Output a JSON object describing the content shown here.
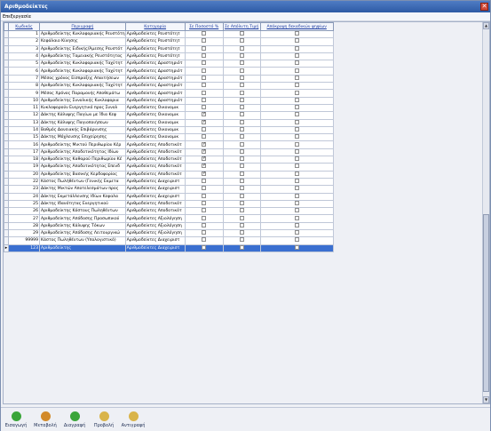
{
  "window": {
    "title": "Αριθμοδείκτες",
    "close_glyph": "✕"
  },
  "menu": {
    "tools": "Επεξεργασία"
  },
  "grid": {
    "columns": [
      "Κωδικός",
      "Περιγραφή",
      "Κατηγορία",
      "Σε Ποσοστό %",
      "Σε Απόλυτη Τιμή",
      "Απόκρυψη δεκαδικών ψηφίων"
    ],
    "rows": [
      {
        "code": "1",
        "desc": "Αριθμοδείκτης Κυκλοφοριακής Ρευστότη",
        "cat": "Αριθμοδείκτες Ρευστότητ",
        "pct": false,
        "abs": false,
        "hide": false
      },
      {
        "code": "2",
        "desc": "Κεφάλαιο Κίνησης",
        "cat": "Αριθμοδείκτες Ρευστότητ",
        "pct": false,
        "abs": false,
        "hide": false
      },
      {
        "code": "3",
        "desc": "Αριθμοδείκτης Ειδικής/Άμεσης Ρευστότ",
        "cat": "Αριθμοδείκτες Ρευστότητ",
        "pct": false,
        "abs": false,
        "hide": false
      },
      {
        "code": "4",
        "desc": "Αριθμοδείκτης Ταμειακής Ρευστότητας",
        "cat": "Αριθμοδείκτες Ρευστότητ",
        "pct": false,
        "abs": false,
        "hide": false
      },
      {
        "code": "5",
        "desc": "Αριθμοδείκτης Κυκλοφοριακής Ταχύτητ",
        "cat": "Αριθμοδείκτες Δραστηριότ",
        "pct": false,
        "abs": false,
        "hide": false
      },
      {
        "code": "6",
        "desc": "Αριθμοδείκτης Κυκλοφοριακής Ταχύτητ",
        "cat": "Αριθμοδείκτες Δραστηριότ",
        "pct": false,
        "abs": false,
        "hide": false
      },
      {
        "code": "7",
        "desc": "Μέσος χρόνος Είσπραξης Απαιτήσεων",
        "cat": "Αριθμοδείκτες Δραστηριότ",
        "pct": false,
        "abs": false,
        "hide": false
      },
      {
        "code": "8",
        "desc": "Αριθμοδείκτης Κυκλοφοριακής Ταχύτητ",
        "cat": "Αριθμοδείκτες Δραστηριότ",
        "pct": false,
        "abs": false,
        "hide": false
      },
      {
        "code": "9",
        "desc": "Μέσος Χρόνος Παραμονής Αποθεμάτω",
        "cat": "Αριθμοδείκτες Δραστηριότ",
        "pct": false,
        "abs": false,
        "hide": false
      },
      {
        "code": "10",
        "desc": "Αριθμοδείκτης Συνολικής Κυκλοφορια",
        "cat": "Αριθμοδείκτες Δραστηριότ",
        "pct": false,
        "abs": false,
        "hide": false
      },
      {
        "code": "11",
        "desc": "Κυκλοφορούν Ενεργητικό προς Συνολ",
        "cat": "Αριθμοδείκτες Οικονομικ",
        "pct": false,
        "abs": false,
        "hide": false
      },
      {
        "code": "12",
        "desc": "Δάκτης Κάλυψης Παγίων με Ίδια Κεφ",
        "cat": "Αριθμοδείκτες Οικονομικ",
        "pct": true,
        "abs": false,
        "hide": false
      },
      {
        "code": "13",
        "desc": "Δάκτης Κάλυψης Παγιοποιήσεων",
        "cat": "Αριθμοδείκτες Οικονομικ",
        "pct": true,
        "abs": false,
        "hide": false
      },
      {
        "code": "14",
        "desc": "Βαθμός Δανειακής Επιβάρυνσης",
        "cat": "Αριθμοδείκτες Οικονομικ",
        "pct": false,
        "abs": false,
        "hide": false
      },
      {
        "code": "15",
        "desc": "Δάκτης Μόχλευσης Επιχείρησης",
        "cat": "Αριθμοδείκτες Οικονομικ",
        "pct": false,
        "abs": false,
        "hide": false
      },
      {
        "code": "16",
        "desc": "Αριθμοδείκτης Μικτού Περιθωρίου Κέρ",
        "cat": "Αριθμοδείκτες Αποδοτικότ",
        "pct": true,
        "abs": false,
        "hide": false
      },
      {
        "code": "17",
        "desc": "Αριθμοδείκτης Αποδοτικότητας Ιδίων",
        "cat": "Αριθμοδείκτες Αποδοτικότ",
        "pct": true,
        "abs": false,
        "hide": false
      },
      {
        "code": "18",
        "desc": "Αριθμοδείκτης Καθαρού Περιθωρίου Κέ",
        "cat": "Αριθμοδείκτες Αποδοτικότ",
        "pct": true,
        "abs": false,
        "hide": false
      },
      {
        "code": "19",
        "desc": "Αριθμοδείκτης Αποδοτικότητας Επενδ",
        "cat": "Αριθμοδείκτες Αποδοτικότ",
        "pct": true,
        "abs": false,
        "hide": false
      },
      {
        "code": "20",
        "desc": "Αριθμοδείκτης Βασικής Κερδοφορίας",
        "cat": "Αριθμοδείκτες Αποδοτικότ",
        "pct": true,
        "abs": false,
        "hide": false
      },
      {
        "code": "22",
        "desc": "Κάστος Πωλήθέντων (Γενικής Εκμετα",
        "cat": "Αριθμοδείκτες Διαχειριστ",
        "pct": false,
        "abs": false,
        "hide": false
      },
      {
        "code": "23",
        "desc": "Δάκτης Μικτών Αποτελεσμάτων προς",
        "cat": "Αριθμοδείκτες Διαχειριστ",
        "pct": false,
        "abs": false,
        "hide": false
      },
      {
        "code": "24",
        "desc": "Δάκτης Εκμετάλλευσης Ιδίων Κεφαλα",
        "cat": "Αριθμοδείκτες Διαχειριστ",
        "pct": false,
        "abs": false,
        "hide": false
      },
      {
        "code": "25",
        "desc": "Δάκτης Ιδανότητας Ενεργητικού",
        "cat": "Αριθμοδείκτες Αποδοτικότ",
        "pct": false,
        "abs": false,
        "hide": false
      },
      {
        "code": "26",
        "desc": "Αριθμοδείκτης Κόστους Πωληθέντων",
        "cat": "Αριθμοδείκτες Αποδοτικότ",
        "pct": false,
        "abs": false,
        "hide": false
      },
      {
        "code": "27",
        "desc": "Αριθμοδείκτης Απόδοσης Προσωπικού",
        "cat": "Αριθμοδείκτες Αξιολόγηση",
        "pct": false,
        "abs": false,
        "hide": false
      },
      {
        "code": "28",
        "desc": "Αριθμοδείκτης Κάλυψης Τόκων",
        "cat": "Αριθμοδείκτες Αξιολόγηση",
        "pct": false,
        "abs": false,
        "hide": false
      },
      {
        "code": "29",
        "desc": "Αριθμοδείκτης Απόδοσης Λειτουργικώ",
        "cat": "Αριθμοδείκτες Αξιολόγηση",
        "pct": false,
        "abs": false,
        "hide": false
      },
      {
        "code": "99999",
        "desc": "Κάστος Πωληθέντων (Υπολογιστικό)",
        "cat": "Αριθμοδείκτες Διαχειριστ",
        "pct": false,
        "abs": false,
        "hide": false
      },
      {
        "code": "123",
        "desc": "Αριθμοδείκτης",
        "cat": "Αριθμοδείκτες Διαχειριστ",
        "pct": false,
        "abs": false,
        "hide": false,
        "selected": true
      }
    ]
  },
  "toolbar": {
    "buttons": [
      {
        "id": "new",
        "label": "Εισαγωγή",
        "color": "#3aa53a",
        "icon": "add-icon"
      },
      {
        "id": "edit",
        "label": "Μεταβολή",
        "color": "#d28a2a",
        "icon": "edit-icon"
      },
      {
        "id": "delete",
        "label": "Διαγραφή",
        "color": "#3aa53a",
        "icon": "delete-icon"
      },
      {
        "id": "view",
        "label": "Προβολή",
        "color": "#d9b44a",
        "icon": "view-icon"
      },
      {
        "id": "copy",
        "label": "Αντιγραφή",
        "color": "#d9b44a",
        "icon": "copy-icon"
      }
    ]
  }
}
